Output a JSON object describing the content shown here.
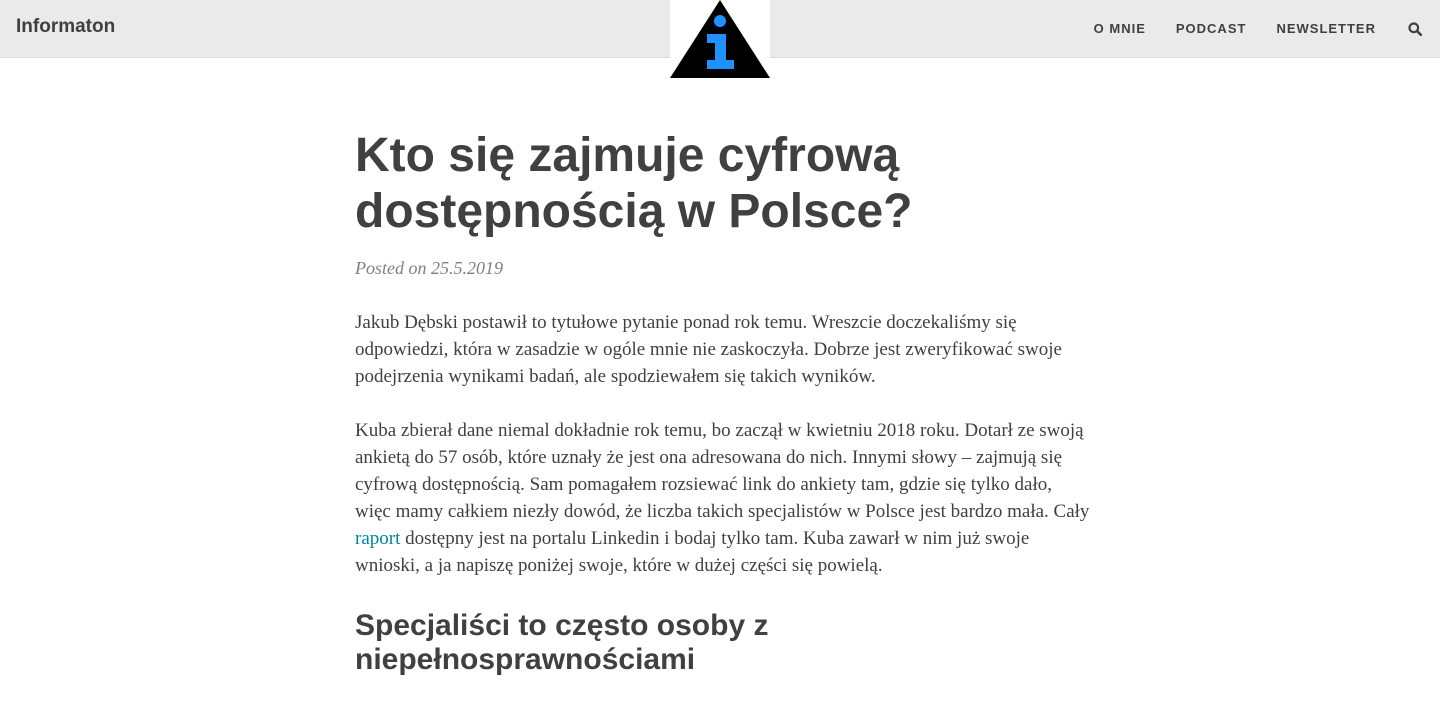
{
  "site": {
    "brand": "Informaton"
  },
  "nav": {
    "items": [
      "O MNIE",
      "PODCAST",
      "NEWSLETTER"
    ]
  },
  "colors": {
    "navbar_bg": "#eaeaea",
    "text": "#404040",
    "meta": "#808080",
    "link": "#0085a1",
    "logo_blue": "#1e90ff"
  },
  "icons": {
    "logo": "info-triangle-icon",
    "search": "search-icon"
  },
  "post": {
    "title": "Kto się zajmuje cyfrową dostępnością w Polsce?",
    "meta": "Posted on 25.5.2019",
    "paragraph1": "Jakub Dębski postawił to tytułowe pytanie ponad rok temu. Wreszcie doczekaliśmy się odpowiedzi, która w zasadzie w ogóle mnie nie zaskoczyła. Dobrze jest zweryfikować swoje podejrzenia wynikami badań, ale spodziewałem się takich wyników.",
    "paragraph2_before": "Kuba zbierał dane niemal dokładnie rok temu, bo zaczął w kwietniu 2018 roku. Dotarł ze swoją ankietą do 57 osób, które uznały że jest ona adresowana do nich. Innymi słowy – zajmują się cyfrową dostępnością. Sam pomagałem rozsiewać link do ankiety tam, gdzie się tylko dało, więc mamy całkiem niezły dowód, że liczba takich specjalistów w Polsce jest bardzo mała. Cały ",
    "paragraph2_link": "raport",
    "paragraph2_after": " dostępny jest na portalu Linkedin i bodaj tylko tam. Kuba zawarł w nim już swoje wnioski, a ja napiszę poniżej swoje, które w dużej części się powielą.",
    "subheading": "Specjaliści to często osoby z niepełnosprawnościami"
  }
}
